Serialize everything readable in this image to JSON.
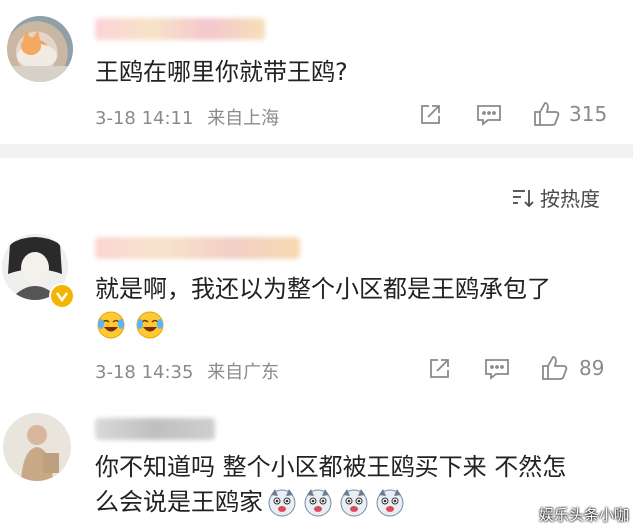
{
  "comments": [
    {
      "text": "王鸥在哪里你就带王鸥?",
      "time": "3-18 14:11",
      "location": "来自上海",
      "likes": "315"
    },
    {
      "text": "就是啊，我还以为整个小区都是王鸥承包了",
      "time": "3-18 14:35",
      "location": "来自广东",
      "likes": "89"
    },
    {
      "text_line1": "你不知道吗 整个小区都被王鸥买下来 不然怎",
      "text_line2": "么会说是王鸥家"
    }
  ],
  "sort": {
    "label": "按热度"
  },
  "watermark": "娱乐头条小咖",
  "colors": {
    "text": "#222222",
    "meta": "#8a8a8a",
    "divider": "#f2f2f2",
    "verified_badge": "#f5b400"
  }
}
